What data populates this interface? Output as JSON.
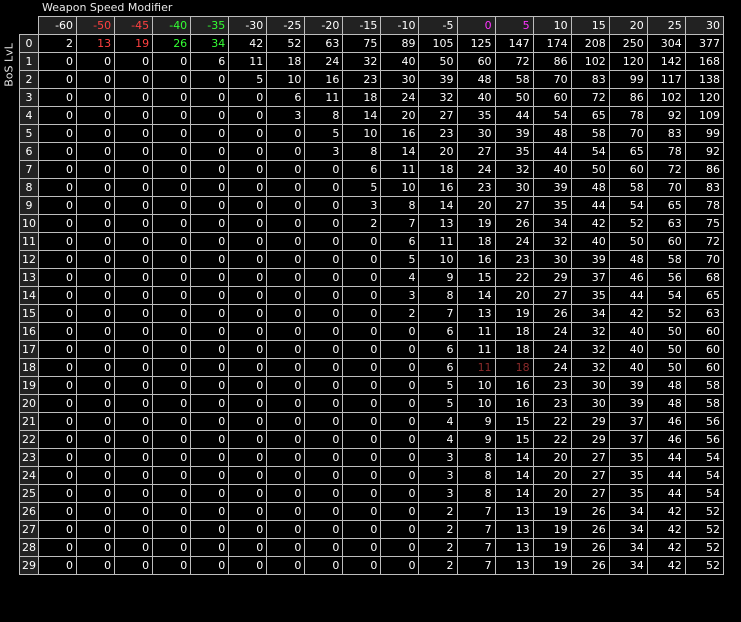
{
  "title": "Weapon Speed Modifier",
  "side_label": "BoS LvL",
  "colors": {
    "background": "#000000",
    "text": "#ffffff",
    "grid": "#bdbdbd",
    "header_bg": "#222222",
    "red": "#ff4040",
    "green": "#33ff33",
    "magenta": "#ff33ff",
    "dark_red": "#8a2a2a"
  },
  "columns": [
    {
      "label": "-60",
      "color": "text"
    },
    {
      "label": "-50",
      "color": "red"
    },
    {
      "label": "-45",
      "color": "red"
    },
    {
      "label": "-40",
      "color": "green"
    },
    {
      "label": "-35",
      "color": "green"
    },
    {
      "label": "-30",
      "color": "text"
    },
    {
      "label": "-25",
      "color": "text"
    },
    {
      "label": "-20",
      "color": "text"
    },
    {
      "label": "-15",
      "color": "text"
    },
    {
      "label": "-10",
      "color": "text"
    },
    {
      "label": "-5",
      "color": "text"
    },
    {
      "label": "0",
      "color": "magenta"
    },
    {
      "label": "5",
      "color": "magenta"
    },
    {
      "label": "10",
      "color": "text"
    },
    {
      "label": "15",
      "color": "text"
    },
    {
      "label": "20",
      "color": "text"
    },
    {
      "label": "25",
      "color": "text"
    },
    {
      "label": "30",
      "color": "text"
    }
  ],
  "highlights": [
    {
      "row": 0,
      "col": 1,
      "color": "red"
    },
    {
      "row": 0,
      "col": 2,
      "color": "red"
    },
    {
      "row": 0,
      "col": 3,
      "color": "green"
    },
    {
      "row": 0,
      "col": 4,
      "color": "green"
    },
    {
      "row": 18,
      "col": 11,
      "color": "dark_red"
    },
    {
      "row": 18,
      "col": 12,
      "color": "dark_red"
    }
  ],
  "rows": [
    {
      "level": "0",
      "values": [
        "2",
        "13",
        "19",
        "26",
        "34",
        "42",
        "52",
        "63",
        "75",
        "89",
        "105",
        "125",
        "147",
        "174",
        "208",
        "250",
        "304",
        "377"
      ]
    },
    {
      "level": "1",
      "values": [
        "0",
        "0",
        "0",
        "0",
        "6",
        "11",
        "18",
        "24",
        "32",
        "40",
        "50",
        "60",
        "72",
        "86",
        "102",
        "120",
        "142",
        "168"
      ]
    },
    {
      "level": "2",
      "values": [
        "0",
        "0",
        "0",
        "0",
        "0",
        "5",
        "10",
        "16",
        "23",
        "30",
        "39",
        "48",
        "58",
        "70",
        "83",
        "99",
        "117",
        "138"
      ]
    },
    {
      "level": "3",
      "values": [
        "0",
        "0",
        "0",
        "0",
        "0",
        "0",
        "6",
        "11",
        "18",
        "24",
        "32",
        "40",
        "50",
        "60",
        "72",
        "86",
        "102",
        "120"
      ]
    },
    {
      "level": "4",
      "values": [
        "0",
        "0",
        "0",
        "0",
        "0",
        "0",
        "3",
        "8",
        "14",
        "20",
        "27",
        "35",
        "44",
        "54",
        "65",
        "78",
        "92",
        "109"
      ]
    },
    {
      "level": "5",
      "values": [
        "0",
        "0",
        "0",
        "0",
        "0",
        "0",
        "0",
        "5",
        "10",
        "16",
        "23",
        "30",
        "39",
        "48",
        "58",
        "70",
        "83",
        "99"
      ]
    },
    {
      "level": "6",
      "values": [
        "0",
        "0",
        "0",
        "0",
        "0",
        "0",
        "0",
        "3",
        "8",
        "14",
        "20",
        "27",
        "35",
        "44",
        "54",
        "65",
        "78",
        "92"
      ]
    },
    {
      "level": "7",
      "values": [
        "0",
        "0",
        "0",
        "0",
        "0",
        "0",
        "0",
        "0",
        "6",
        "11",
        "18",
        "24",
        "32",
        "40",
        "50",
        "60",
        "72",
        "86"
      ]
    },
    {
      "level": "8",
      "values": [
        "0",
        "0",
        "0",
        "0",
        "0",
        "0",
        "0",
        "0",
        "5",
        "10",
        "16",
        "23",
        "30",
        "39",
        "48",
        "58",
        "70",
        "83"
      ]
    },
    {
      "level": "9",
      "values": [
        "0",
        "0",
        "0",
        "0",
        "0",
        "0",
        "0",
        "0",
        "3",
        "8",
        "14",
        "20",
        "27",
        "35",
        "44",
        "54",
        "65",
        "78"
      ]
    },
    {
      "level": "10",
      "values": [
        "0",
        "0",
        "0",
        "0",
        "0",
        "0",
        "0",
        "0",
        "2",
        "7",
        "13",
        "19",
        "26",
        "34",
        "42",
        "52",
        "63",
        "75"
      ]
    },
    {
      "level": "11",
      "values": [
        "0",
        "0",
        "0",
        "0",
        "0",
        "0",
        "0",
        "0",
        "0",
        "6",
        "11",
        "18",
        "24",
        "32",
        "40",
        "50",
        "60",
        "72"
      ]
    },
    {
      "level": "12",
      "values": [
        "0",
        "0",
        "0",
        "0",
        "0",
        "0",
        "0",
        "0",
        "0",
        "5",
        "10",
        "16",
        "23",
        "30",
        "39",
        "48",
        "58",
        "70"
      ]
    },
    {
      "level": "13",
      "values": [
        "0",
        "0",
        "0",
        "0",
        "0",
        "0",
        "0",
        "0",
        "0",
        "4",
        "9",
        "15",
        "22",
        "29",
        "37",
        "46",
        "56",
        "68"
      ]
    },
    {
      "level": "14",
      "values": [
        "0",
        "0",
        "0",
        "0",
        "0",
        "0",
        "0",
        "0",
        "0",
        "3",
        "8",
        "14",
        "20",
        "27",
        "35",
        "44",
        "54",
        "65"
      ]
    },
    {
      "level": "15",
      "values": [
        "0",
        "0",
        "0",
        "0",
        "0",
        "0",
        "0",
        "0",
        "0",
        "2",
        "7",
        "13",
        "19",
        "26",
        "34",
        "42",
        "52",
        "63"
      ]
    },
    {
      "level": "16",
      "values": [
        "0",
        "0",
        "0",
        "0",
        "0",
        "0",
        "0",
        "0",
        "0",
        "0",
        "6",
        "11",
        "18",
        "24",
        "32",
        "40",
        "50",
        "60"
      ]
    },
    {
      "level": "17",
      "values": [
        "0",
        "0",
        "0",
        "0",
        "0",
        "0",
        "0",
        "0",
        "0",
        "0",
        "6",
        "11",
        "18",
        "24",
        "32",
        "40",
        "50",
        "60"
      ]
    },
    {
      "level": "18",
      "values": [
        "0",
        "0",
        "0",
        "0",
        "0",
        "0",
        "0",
        "0",
        "0",
        "0",
        "6",
        "11",
        "18",
        "24",
        "32",
        "40",
        "50",
        "60"
      ]
    },
    {
      "level": "19",
      "values": [
        "0",
        "0",
        "0",
        "0",
        "0",
        "0",
        "0",
        "0",
        "0",
        "0",
        "5",
        "10",
        "16",
        "23",
        "30",
        "39",
        "48",
        "58"
      ]
    },
    {
      "level": "20",
      "values": [
        "0",
        "0",
        "0",
        "0",
        "0",
        "0",
        "0",
        "0",
        "0",
        "0",
        "5",
        "10",
        "16",
        "23",
        "30",
        "39",
        "48",
        "58"
      ]
    },
    {
      "level": "21",
      "values": [
        "0",
        "0",
        "0",
        "0",
        "0",
        "0",
        "0",
        "0",
        "0",
        "0",
        "4",
        "9",
        "15",
        "22",
        "29",
        "37",
        "46",
        "56"
      ]
    },
    {
      "level": "22",
      "values": [
        "0",
        "0",
        "0",
        "0",
        "0",
        "0",
        "0",
        "0",
        "0",
        "0",
        "4",
        "9",
        "15",
        "22",
        "29",
        "37",
        "46",
        "56"
      ]
    },
    {
      "level": "23",
      "values": [
        "0",
        "0",
        "0",
        "0",
        "0",
        "0",
        "0",
        "0",
        "0",
        "0",
        "3",
        "8",
        "14",
        "20",
        "27",
        "35",
        "44",
        "54"
      ]
    },
    {
      "level": "24",
      "values": [
        "0",
        "0",
        "0",
        "0",
        "0",
        "0",
        "0",
        "0",
        "0",
        "0",
        "3",
        "8",
        "14",
        "20",
        "27",
        "35",
        "44",
        "54"
      ]
    },
    {
      "level": "25",
      "values": [
        "0",
        "0",
        "0",
        "0",
        "0",
        "0",
        "0",
        "0",
        "0",
        "0",
        "3",
        "8",
        "14",
        "20",
        "27",
        "35",
        "44",
        "54"
      ]
    },
    {
      "level": "26",
      "values": [
        "0",
        "0",
        "0",
        "0",
        "0",
        "0",
        "0",
        "0",
        "0",
        "0",
        "2",
        "7",
        "13",
        "19",
        "26",
        "34",
        "42",
        "52"
      ]
    },
    {
      "level": "27",
      "values": [
        "0",
        "0",
        "0",
        "0",
        "0",
        "0",
        "0",
        "0",
        "0",
        "0",
        "2",
        "7",
        "13",
        "19",
        "26",
        "34",
        "42",
        "52"
      ]
    },
    {
      "level": "28",
      "values": [
        "0",
        "0",
        "0",
        "0",
        "0",
        "0",
        "0",
        "0",
        "0",
        "0",
        "2",
        "7",
        "13",
        "19",
        "26",
        "34",
        "42",
        "52"
      ]
    },
    {
      "level": "29",
      "values": [
        "0",
        "0",
        "0",
        "0",
        "0",
        "0",
        "0",
        "0",
        "0",
        "0",
        "2",
        "7",
        "13",
        "19",
        "26",
        "34",
        "42",
        "52"
      ]
    }
  ]
}
